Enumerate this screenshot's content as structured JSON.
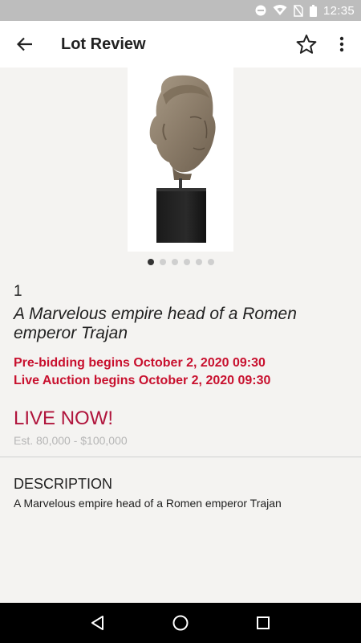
{
  "status_bar": {
    "time": "12:35",
    "icons": [
      "do-not-disturb-icon",
      "wifi-icon",
      "no-sim-icon",
      "battery-icon"
    ]
  },
  "app_bar": {
    "title": "Lot Review",
    "back_icon": "arrow-back-icon",
    "star_icon": "star-outline-icon",
    "more_icon": "more-vert-icon"
  },
  "gallery": {
    "image_subject": "marble-bust-on-pedestal",
    "dot_count": 6,
    "active_index": 0
  },
  "lot": {
    "number": "1",
    "title": "A Marvelous empire head of a Romen emperor Trajan",
    "prebidding": "Pre-bidding begins October 2, 2020  09:30",
    "live_auction": "Live Auction begins October 2, 2020  09:30",
    "status": "LIVE NOW!",
    "estimate": "Est. 80,000 - $100,000"
  },
  "description": {
    "heading": "DESCRIPTION",
    "text": "A Marvelous empire head of a Romen emperor Trajan"
  },
  "nav_bar": {
    "icons": [
      "back-triangle-icon",
      "home-circle-icon",
      "recents-square-icon"
    ]
  },
  "colors": {
    "accent_red": "#c8102e",
    "live_now": "#b0143c",
    "background": "#f4f3f1",
    "status_bar": "#bdbdbd"
  }
}
